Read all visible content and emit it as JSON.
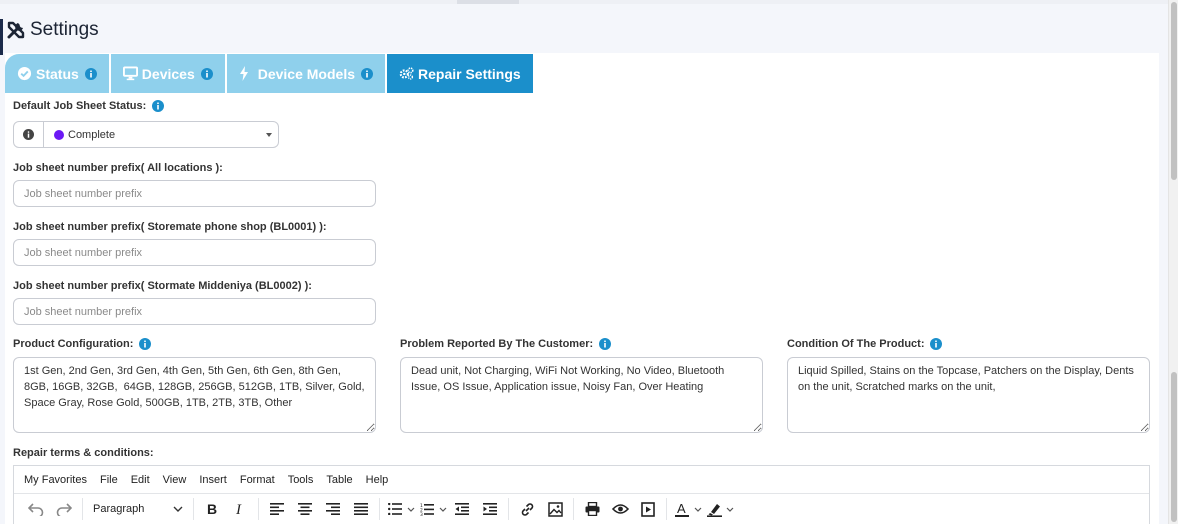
{
  "page": {
    "title": "Settings"
  },
  "tabs": [
    {
      "label": "Status",
      "icon": "check-circle-icon",
      "has_info": true,
      "active": false
    },
    {
      "label": "Devices",
      "icon": "monitor-icon",
      "has_info": true,
      "active": false
    },
    {
      "label": "Device Models",
      "icon": "bolt-icon",
      "has_info": true,
      "active": false
    },
    {
      "label": "Repair Settings",
      "icon": "gears-icon",
      "has_info": false,
      "active": true
    }
  ],
  "form": {
    "default_status": {
      "label": "Default Job Sheet Status:",
      "value": "Complete",
      "dot_color": "#6c19f5"
    },
    "prefix_all": {
      "label": "Job sheet number prefix( All locations ):",
      "placeholder": "Job sheet number prefix"
    },
    "prefix_bl0001": {
      "label": "Job sheet number prefix( Storemate phone shop (BL0001) ):",
      "placeholder": "Job sheet number prefix"
    },
    "prefix_bl0002": {
      "label": "Job sheet number prefix( Stormate Middeniya (BL0002) ):",
      "placeholder": "Job sheet number prefix"
    },
    "product_configuration": {
      "label": "Product Configuration:",
      "value": "1st Gen, 2nd Gen, 3rd Gen, 4th Gen, 5th Gen, 6th Gen, 8th Gen, 8GB, 16GB, 32GB,  64GB, 128GB, 256GB, 512GB, 1TB, Silver, Gold, Space Gray, Rose Gold, 500GB, 1TB, 2TB, 3TB, Other"
    },
    "problem_reported": {
      "label": "Problem Reported By The Customer:",
      "value": "Dead unit, Not Charging, WiFi Not Working, No Video, Bluetooth Issue, OS Issue, Application issue, Noisy Fan, Over Heating"
    },
    "condition": {
      "label": "Condition Of The Product:",
      "value": "Liquid Spilled, Stains on the Topcase, Patchers on the Display, Dents on the unit, Scratched marks on the unit,"
    },
    "repair_terms": {
      "label": "Repair terms & conditions:"
    }
  },
  "editor": {
    "menu": [
      "My Favorites",
      "File",
      "Edit",
      "View",
      "Insert",
      "Format",
      "Tools",
      "Table",
      "Help"
    ],
    "block_format": "Paragraph"
  },
  "colors": {
    "tab_inactive": "#8fd0ec",
    "tab_active": "#1b8fcb",
    "info_icon": "#1b8fcb"
  }
}
